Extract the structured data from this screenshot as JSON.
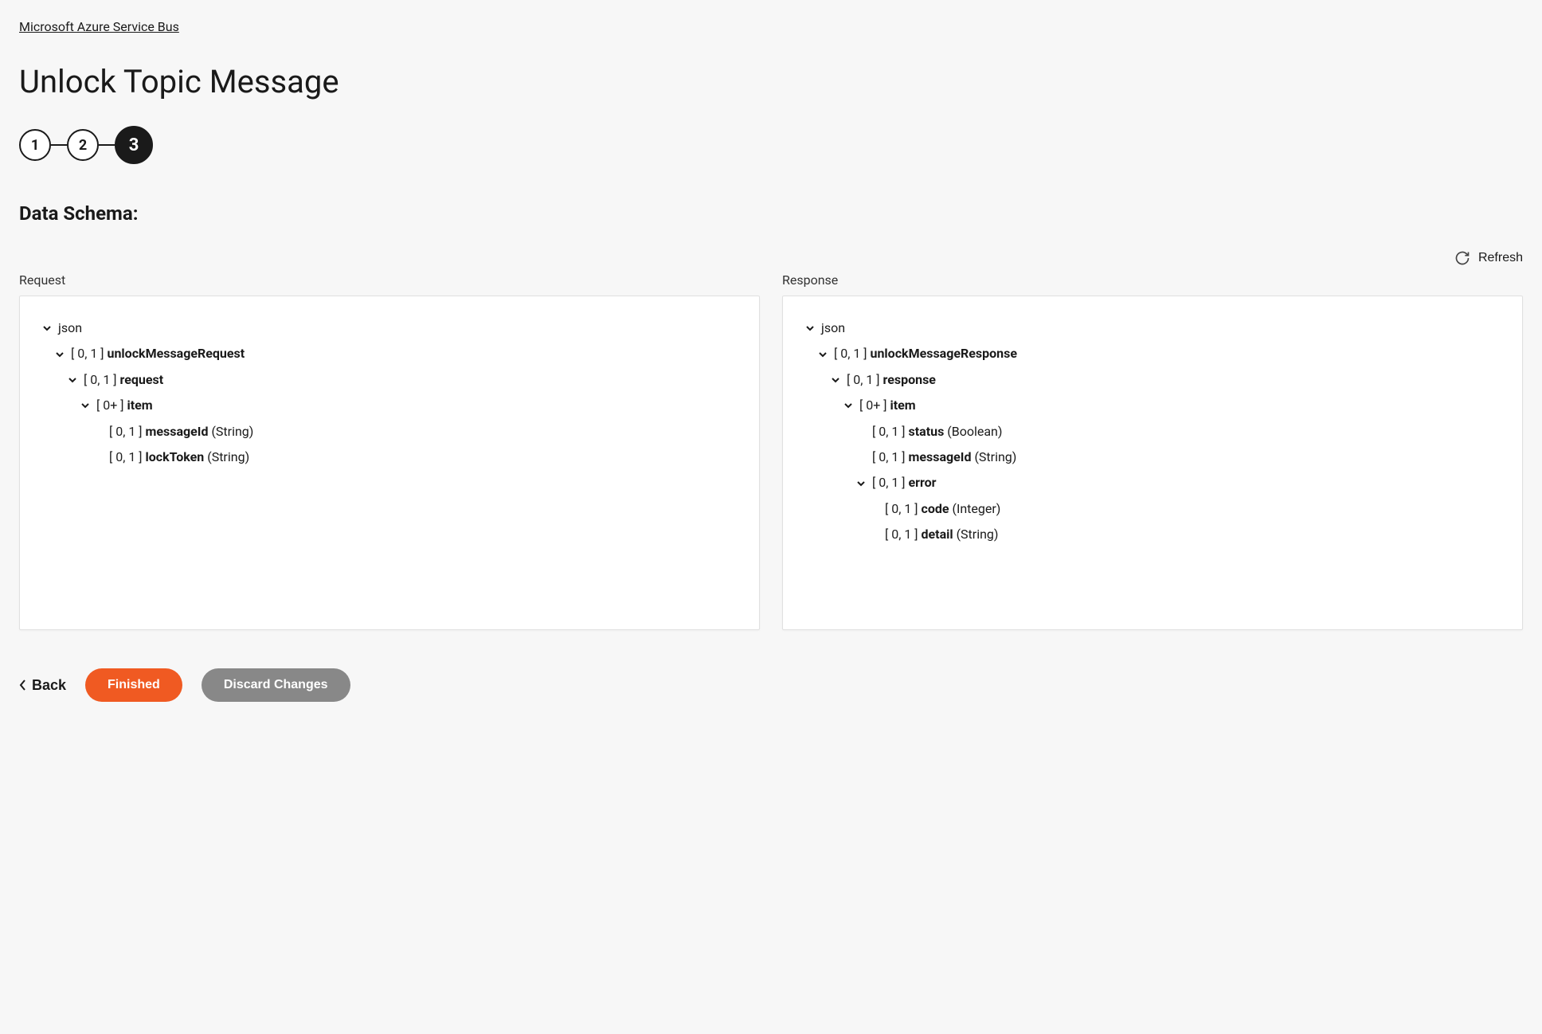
{
  "breadcrumb": "Microsoft Azure Service Bus",
  "page_title": "Unlock Topic Message",
  "stepper": {
    "steps": [
      "1",
      "2",
      "3"
    ],
    "active_index": 2
  },
  "section_title": "Data Schema:",
  "refresh_label": "Refresh",
  "columns": {
    "request": {
      "label": "Request",
      "tree": [
        {
          "indent": 0,
          "expandable": true,
          "card": "",
          "name": "json",
          "name_bold": false,
          "type": ""
        },
        {
          "indent": 1,
          "expandable": true,
          "card": "[ 0, 1 ]",
          "name": "unlockMessageRequest",
          "name_bold": true,
          "type": ""
        },
        {
          "indent": 2,
          "expandable": true,
          "card": "[ 0, 1 ]",
          "name": "request",
          "name_bold": true,
          "type": ""
        },
        {
          "indent": 3,
          "expandable": true,
          "card": "[ 0+ ]",
          "name": "item",
          "name_bold": true,
          "type": ""
        },
        {
          "indent": 4,
          "expandable": false,
          "card": "[ 0, 1 ]",
          "name": "messageId",
          "name_bold": true,
          "type": "(String)"
        },
        {
          "indent": 4,
          "expandable": false,
          "card": "[ 0, 1 ]",
          "name": "lockToken",
          "name_bold": true,
          "type": "(String)"
        }
      ]
    },
    "response": {
      "label": "Response",
      "tree": [
        {
          "indent": 0,
          "expandable": true,
          "card": "",
          "name": "json",
          "name_bold": false,
          "type": ""
        },
        {
          "indent": 1,
          "expandable": true,
          "card": "[ 0, 1 ]",
          "name": "unlockMessageResponse",
          "name_bold": true,
          "type": ""
        },
        {
          "indent": 2,
          "expandable": true,
          "card": "[ 0, 1 ]",
          "name": "response",
          "name_bold": true,
          "type": ""
        },
        {
          "indent": 3,
          "expandable": true,
          "card": "[ 0+ ]",
          "name": "item",
          "name_bold": true,
          "type": ""
        },
        {
          "indent": 4,
          "expandable": false,
          "card": "[ 0, 1 ]",
          "name": "status",
          "name_bold": true,
          "type": "(Boolean)"
        },
        {
          "indent": 4,
          "expandable": false,
          "card": "[ 0, 1 ]",
          "name": "messageId",
          "name_bold": true,
          "type": "(String)"
        },
        {
          "indent": 4,
          "expandable": true,
          "card": "[ 0, 1 ]",
          "name": "error",
          "name_bold": true,
          "type": ""
        },
        {
          "indent": 5,
          "expandable": false,
          "card": "[ 0, 1 ]",
          "name": "code",
          "name_bold": true,
          "type": "(Integer)"
        },
        {
          "indent": 5,
          "expandable": false,
          "card": "[ 0, 1 ]",
          "name": "detail",
          "name_bold": true,
          "type": "(String)"
        }
      ]
    }
  },
  "footer": {
    "back_label": "Back",
    "finished_label": "Finished",
    "discard_label": "Discard Changes"
  }
}
